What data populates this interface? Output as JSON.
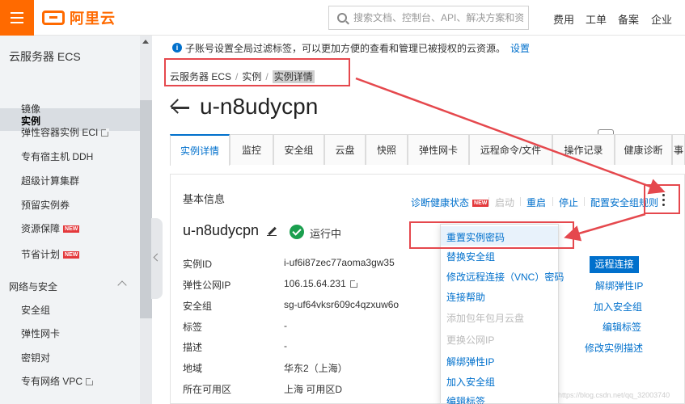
{
  "header": {
    "logo_text": "阿里云",
    "search_placeholder": "搜索文档、控制台、API、解决方案和资源",
    "nav": [
      "费用",
      "工单",
      "备案",
      "企业"
    ]
  },
  "sidebar": {
    "title": "云服务器 ECS",
    "items": [
      {
        "label": "实例",
        "active": true
      },
      {
        "label": "镜像"
      },
      {
        "label": "弹性容器实例 ECI",
        "external": true
      },
      {
        "label": "专有宿主机 DDH"
      },
      {
        "label": "超级计算集群"
      },
      {
        "label": "预留实例券"
      },
      {
        "label": "资源保障",
        "badge": "NEW"
      },
      {
        "label": "节省计划",
        "badge": "NEW"
      }
    ],
    "section_title": "网络与安全",
    "section_items": [
      {
        "label": "安全组"
      },
      {
        "label": "弹性网卡"
      },
      {
        "label": "密钥对"
      },
      {
        "label": "专有网络 VPC",
        "external": true
      }
    ]
  },
  "notice": {
    "text": "子账号设置全局过滤标签，可以更加方便的查看和管理已被授权的云资源。",
    "link": "设置"
  },
  "breadcrumb": [
    "云服务器 ECS",
    "实例",
    "实例详情"
  ],
  "page_title": "u-n8udycpn",
  "lang_icon": "en",
  "tabs": [
    "实例详情",
    "监控",
    "安全组",
    "云盘",
    "快照",
    "弹性网卡",
    "远程命令/文件",
    "操作记录",
    "健康诊断",
    "事"
  ],
  "basic_info": {
    "title": "基本信息",
    "actions": {
      "diagnose": "诊断健康状态",
      "diagnose_badge": "NEW",
      "start": "启动",
      "restart": "重启",
      "stop": "停止",
      "rules": "配置安全组规则"
    },
    "instance_name": "u-n8udycpn",
    "status": "运行中",
    "fields": [
      {
        "label": "实例ID",
        "value": "i-uf6i87zec77aoma3gw35"
      },
      {
        "label": "弹性公网IP",
        "value": "106.15.64.231"
      },
      {
        "label": "安全组",
        "value": "sg-uf64vksr609c4qzxuw6o"
      },
      {
        "label": "标签",
        "value": "-"
      },
      {
        "label": "描述",
        "value": "-"
      },
      {
        "label": "地域",
        "value": "华东2（上海）"
      },
      {
        "label": "所在可用区",
        "value": "上海 可用区D"
      }
    ],
    "right_actions": {
      "remote_connect": "远程连接",
      "unbind_eip": "解绑弹性IP",
      "join_sg": "加入安全组",
      "edit_tags": "编辑标签",
      "edit_desc": "修改实例描述"
    }
  },
  "dropdown": {
    "items": [
      {
        "label": "重置实例密码",
        "disabled": false
      },
      {
        "label": "替换安全组",
        "disabled": false
      },
      {
        "label": "修改远程连接（VNC）密码",
        "disabled": false
      },
      {
        "label": "连接帮助",
        "disabled": false
      },
      {
        "label": "添加包年包月云盘",
        "disabled": true
      },
      {
        "label": "更换公网IP",
        "disabled": true
      },
      {
        "label": "解绑弹性IP",
        "disabled": false
      },
      {
        "label": "加入安全组",
        "disabled": false
      },
      {
        "label": "编辑标签",
        "disabled": false
      }
    ]
  },
  "watermark": "https://blog.csdn.net/qq_32003740",
  "colors": {
    "brand": "#ff6a00",
    "link": "#0070cc",
    "annotation": "#e5484d",
    "running": "#1a9f4e"
  }
}
